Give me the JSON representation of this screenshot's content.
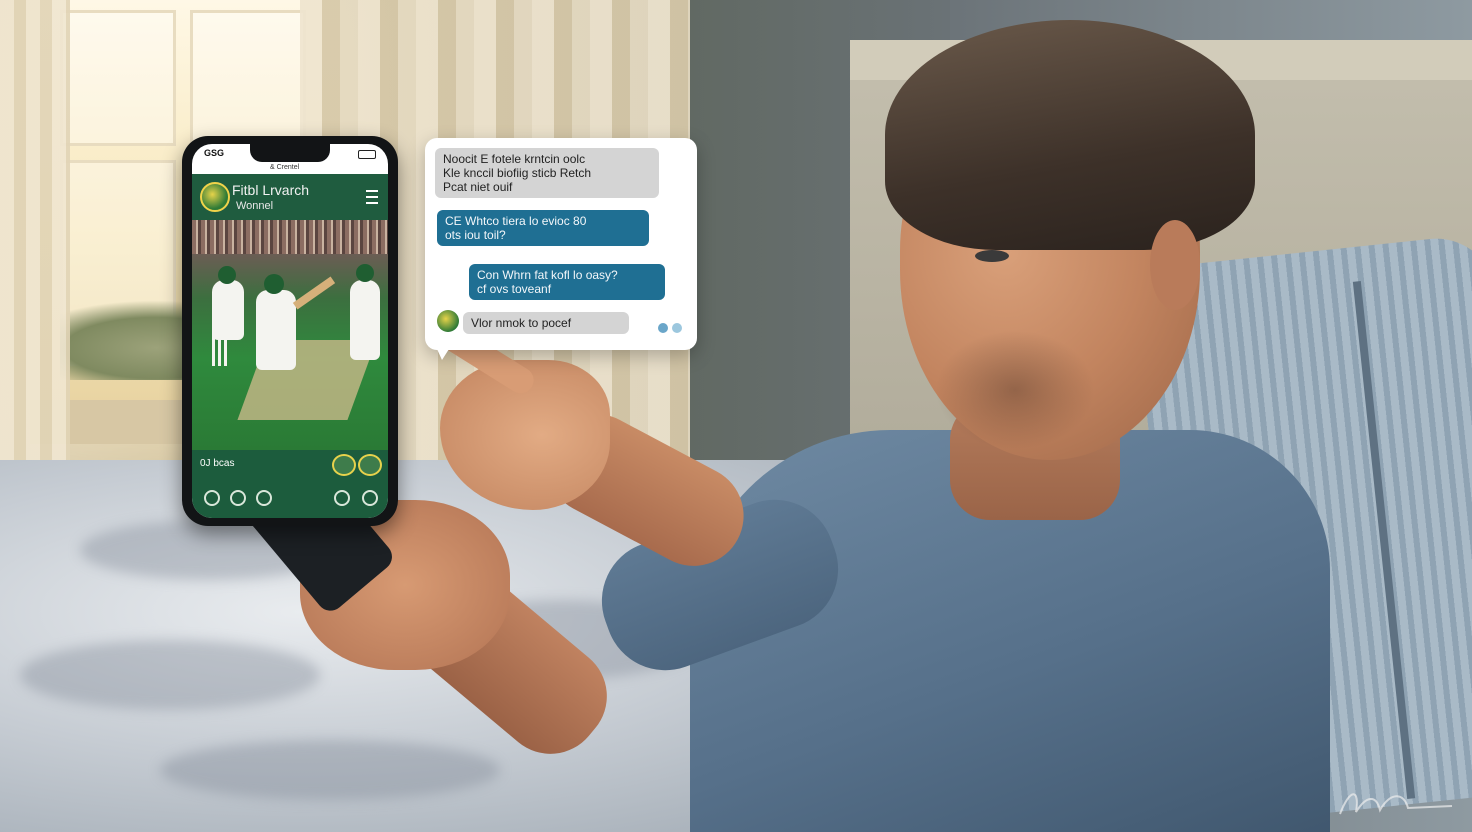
{
  "phone": {
    "status_carrier": "GSG",
    "status_center": "& Crentel",
    "app_title": "Fitbl Lrvarch",
    "app_subtitle": "Wonnel",
    "bottom_label": "0J bcas",
    "menu_icon": "hamburger-menu-icon"
  },
  "chat": {
    "messages": [
      {
        "side": "incoming",
        "text": "Noocit  E fotele krntcin  oolc\nKle knccil biofiig sticb Retch\nPcat niet ouif"
      },
      {
        "side": "outgoing",
        "text": "CE Whtco tiera lo evioc 80\nots iou toil?"
      },
      {
        "side": "outgoing",
        "text": "Con Whrn fat kofl lo oasy?\ncf ovs toveanf"
      },
      {
        "side": "incoming",
        "text": "Vlor nmok to pocef"
      }
    ]
  },
  "colors": {
    "app_green": "#1f5c3f",
    "accent_yellow": "#e7d24c",
    "bubble_blue": "#1f6f93",
    "bubble_gray": "#d4d4d4"
  }
}
